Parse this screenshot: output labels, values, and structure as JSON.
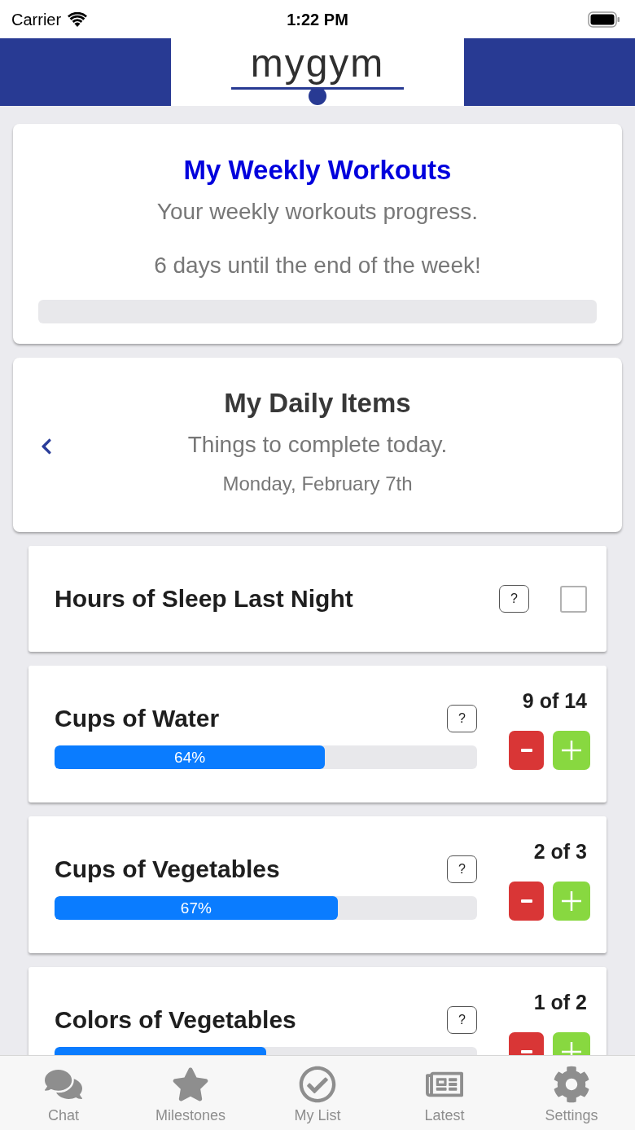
{
  "status_bar": {
    "carrier": "Carrier",
    "time": "1:22 PM"
  },
  "header": {
    "logo": "mygym"
  },
  "weekly_card": {
    "title": "My Weekly Workouts",
    "subtitle": "Your weekly workouts progress.",
    "note": "6 days until the end of the week!",
    "level": 0
  },
  "daily_card": {
    "title": "My Daily Items",
    "subtitle": "Things to complete today.",
    "date": "Monday, February 7th"
  },
  "items": [
    {
      "kind": "checkbox",
      "title": "Hours of Sleep Last Night",
      "help": "?",
      "checked": false
    },
    {
      "kind": "counter",
      "title": "Cups of Water",
      "help": "?",
      "count": "9 of 14",
      "level": 0.64,
      "reading": "64%"
    },
    {
      "kind": "counter",
      "title": "Cups of Vegetables",
      "help": "?",
      "count": "2 of 3",
      "level": 0.67,
      "reading": "67%"
    },
    {
      "kind": "counter",
      "title": "Colors of Vegetables",
      "help": "?",
      "count": "1 of 2",
      "level": 0.5
    }
  ],
  "tab_bar": [
    {
      "label": "Chat",
      "selected": false
    },
    {
      "label": "Milestones",
      "selected": false
    },
    {
      "label": "My List",
      "selected": false
    },
    {
      "label": "Latest",
      "selected": false
    },
    {
      "label": "Settings",
      "selected": false
    }
  ]
}
